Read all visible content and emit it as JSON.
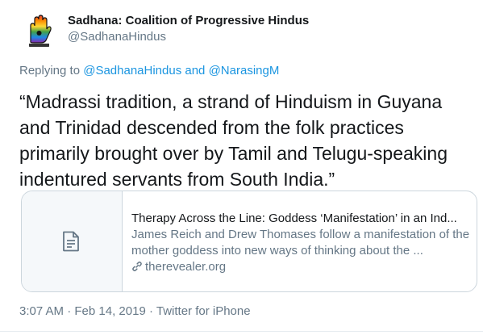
{
  "author": {
    "display_name": "Sadhana: Coalition of Progressive Hindus",
    "handle": "@SadhanaHindus"
  },
  "reply": {
    "prefix": "Replying to ",
    "mention_1": "@SadhanaHindus",
    "conjunction": " and ",
    "mention_2": "@NarasingM"
  },
  "tweet": {
    "text": "“Madrassi tradition, a strand of Hinduism in Guyana and Trinidad descended from the folk practices primarily brought over by Tamil and Telugu-speaking indentured servants from South India.”"
  },
  "card": {
    "icon": "document-icon",
    "title": "Therapy Across the Line: Goddess ‘Manifestation’ in an Ind...",
    "description": "James Reich and Drew Thomases follow a manifestation of the mother goddess into new ways of thinking about the ...",
    "domain": "therevealer.org"
  },
  "meta": {
    "time": "3:07 AM",
    "date": "Feb 14, 2019",
    "source": "Twitter for iPhone",
    "separator": " · "
  },
  "colors": {
    "link": "#1b95e0",
    "secondary_text": "#657786",
    "border": "#ccd6dd"
  }
}
